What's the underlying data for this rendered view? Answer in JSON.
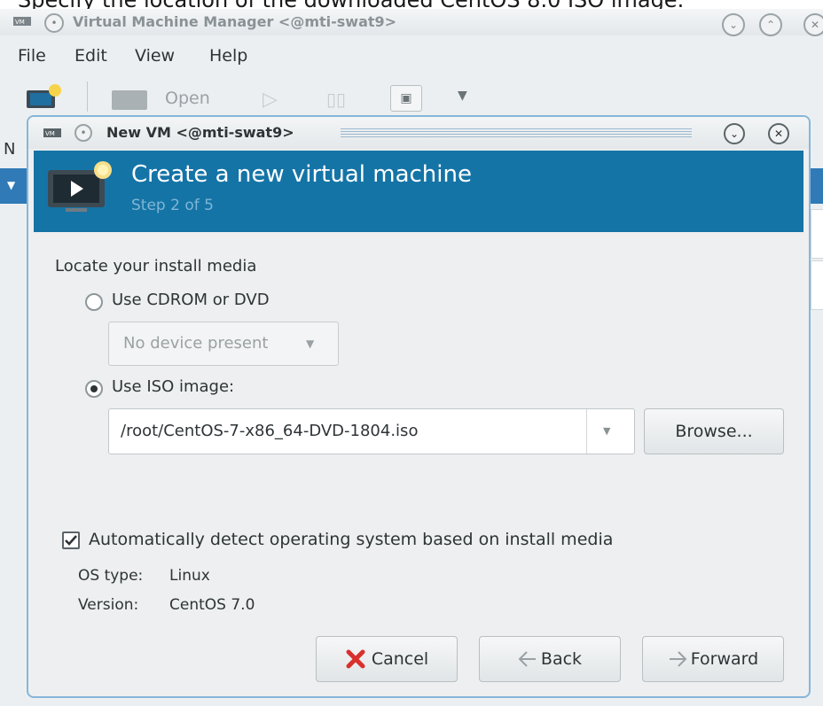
{
  "caption": "Specify the location of the downloaded CentOS 8.0 ISO image.",
  "main_window": {
    "title": "Virtual Machine Manager <@mti-swat9>",
    "menu": [
      "File",
      "Edit",
      "View",
      "Help"
    ],
    "toolbar": {
      "open_label": "Open"
    },
    "side_letter": "N"
  },
  "dialog": {
    "title": "New VM <@mti-swat9>",
    "header_title": "Create a new virtual machine",
    "header_step": "Step 2 of 5",
    "section_label": "Locate your install media",
    "option_cdrom": {
      "label": "Use CDROM or DVD",
      "selected": false
    },
    "cdrom_device": "No device present",
    "option_iso": {
      "label": "Use ISO image:",
      "selected": true
    },
    "iso_path": "/root/CentOS-7-x86_64-DVD-1804.iso",
    "browse_label": "Browse...",
    "auto_detect": {
      "label": "Automatically detect operating system based on install media",
      "checked": true
    },
    "os_type_label": "OS type:",
    "os_type_value": "Linux",
    "version_label": "Version:",
    "version_value": "CentOS 7.0",
    "cancel_label": "Cancel",
    "back_label": "Back",
    "forward_label": "Forward"
  },
  "colors": {
    "header_bg": "#1574a6",
    "dialog_border": "#86b6da",
    "cancel_icon": "#d9302c"
  }
}
